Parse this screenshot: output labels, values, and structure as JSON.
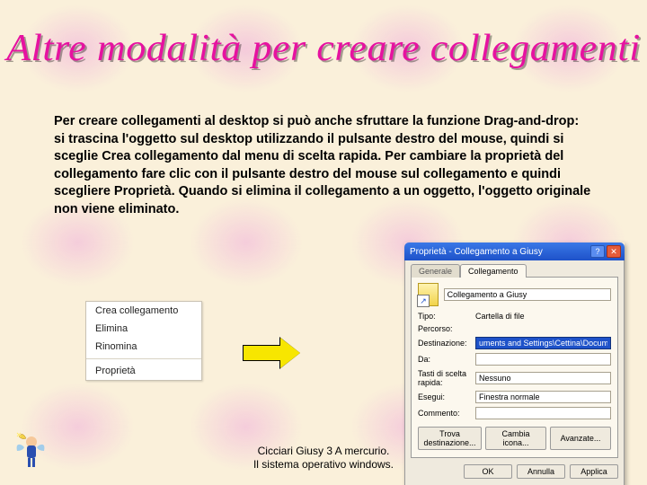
{
  "title": "Altre modalità per creare collegamenti",
  "body_text": "Per creare collegamenti al desktop si può anche sfruttare la funzione Drag-and-drop: si trascina l'oggetto sul desktop utilizzando il pulsante destro del mouse, quindi si sceglie Crea collegamento dal menu di scelta rapida. Per cambiare la proprietà del collegamento fare clic con il pulsante destro del mouse sul collegamento e quindi scegliere Proprietà. Quando si elimina il collegamento a un oggetto, l'oggetto originale non viene eliminato.",
  "context_menu": {
    "items": [
      "Crea collegamento",
      "Elimina",
      "Rinomina"
    ],
    "after_sep": [
      "Proprietà"
    ]
  },
  "properties_dialog": {
    "title": "Proprietà - Collegamento a Giusy",
    "tabs": {
      "general": "Generale",
      "link": "Collegamento"
    },
    "name_value": "Collegamento a Giusy",
    "rows": {
      "tipo": {
        "label": "Tipo:",
        "value": "Cartella di file"
      },
      "percorso": {
        "label": "Percorso:",
        "value": ""
      },
      "destinazione": {
        "label": "Destinazione:",
        "value": "uments and Settings\\Cettina\\Documenti\\Giusy"
      },
      "da": {
        "label": "Da:",
        "value": ""
      },
      "tasti": {
        "label": "Tasti di scelta rapida:",
        "value": "Nessuno"
      },
      "esegui": {
        "label": "Esegui:",
        "value": "Finestra normale"
      },
      "commento": {
        "label": "Commento:",
        "value": ""
      }
    },
    "buttons": {
      "trova": "Trova destinazione...",
      "icona": "Cambia icona...",
      "avanzate": "Avanzate...",
      "ok": "OK",
      "annulla": "Annulla",
      "applica": "Applica"
    }
  },
  "footer": {
    "line1": "Cicciari Giusy 3 A mercurio.",
    "line2": "Il sistema operativo windows."
  }
}
